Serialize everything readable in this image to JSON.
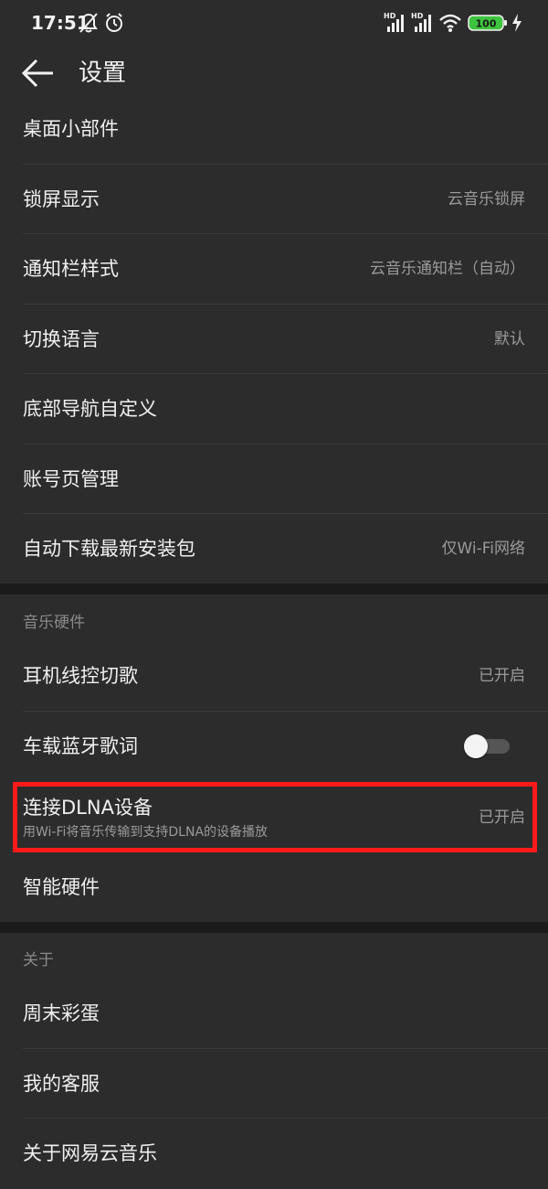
{
  "status_bar": {
    "time": "17:51",
    "battery": "100",
    "signal_label_1": "HD",
    "signal_label_2": "HD"
  },
  "header": {
    "title": "设置"
  },
  "general_items": [
    {
      "label": "桌面小部件",
      "value": ""
    },
    {
      "label": "锁屏显示",
      "value": "云音乐锁屏"
    },
    {
      "label": "通知栏样式",
      "value": "云音乐通知栏（自动）"
    },
    {
      "label": "切换语言",
      "value": "默认"
    },
    {
      "label": "底部导航自定义",
      "value": ""
    },
    {
      "label": "账号页管理",
      "value": ""
    },
    {
      "label": "自动下载最新安装包",
      "value": "仅Wi-Fi网络"
    }
  ],
  "hardware_section": {
    "title": "音乐硬件",
    "headset_label": "耳机线控切歌",
    "headset_value": "已开启",
    "car_lyrics_label": "车载蓝牙歌词",
    "car_lyrics_enabled": false,
    "dlna_label": "连接DLNA设备",
    "dlna_subtitle": "用Wi-Fi将音乐传输到支持DLNA的设备播放",
    "dlna_value": "已开启",
    "smart_hardware_label": "智能硬件"
  },
  "about_section": {
    "title": "关于",
    "items": [
      {
        "label": "周末彩蛋"
      },
      {
        "label": "我的客服"
      },
      {
        "label": "关于网易云音乐"
      }
    ]
  },
  "colors": {
    "background": "#2c2c2c",
    "section_gap": "#1b1b1b",
    "highlight": "#ff1a1a",
    "battery_fill": "#3ec43e"
  }
}
